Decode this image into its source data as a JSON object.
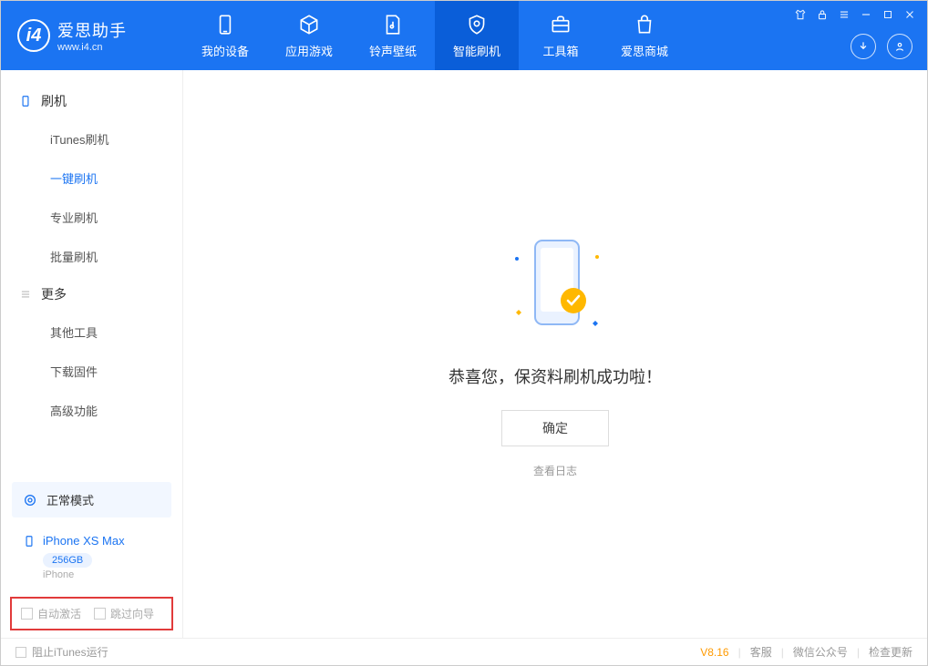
{
  "app": {
    "title": "爱思助手",
    "subtitle": "www.i4.cn"
  },
  "nav": {
    "my_device": "我的设备",
    "apps_games": "应用游戏",
    "ring_wall": "铃声壁纸",
    "smart_flash": "智能刷机",
    "toolbox": "工具箱",
    "store": "爱思商城"
  },
  "sidebar": {
    "group_flash": "刷机",
    "items_flash": [
      "iTunes刷机",
      "一键刷机",
      "专业刷机",
      "批量刷机"
    ],
    "group_more": "更多",
    "items_more": [
      "其他工具",
      "下载固件",
      "高级功能"
    ],
    "mode_label": "正常模式",
    "device": {
      "name": "iPhone XS Max",
      "storage": "256GB",
      "type": "iPhone"
    },
    "auto_activate": "自动激活",
    "skip_guide": "跳过向导"
  },
  "main": {
    "success_msg": "恭喜您，保资料刷机成功啦！",
    "ok_label": "确定",
    "view_log": "查看日志"
  },
  "footer": {
    "block_itunes": "阻止iTunes运行",
    "version": "V8.16",
    "support": "客服",
    "wechat": "微信公众号",
    "check_update": "检查更新"
  }
}
